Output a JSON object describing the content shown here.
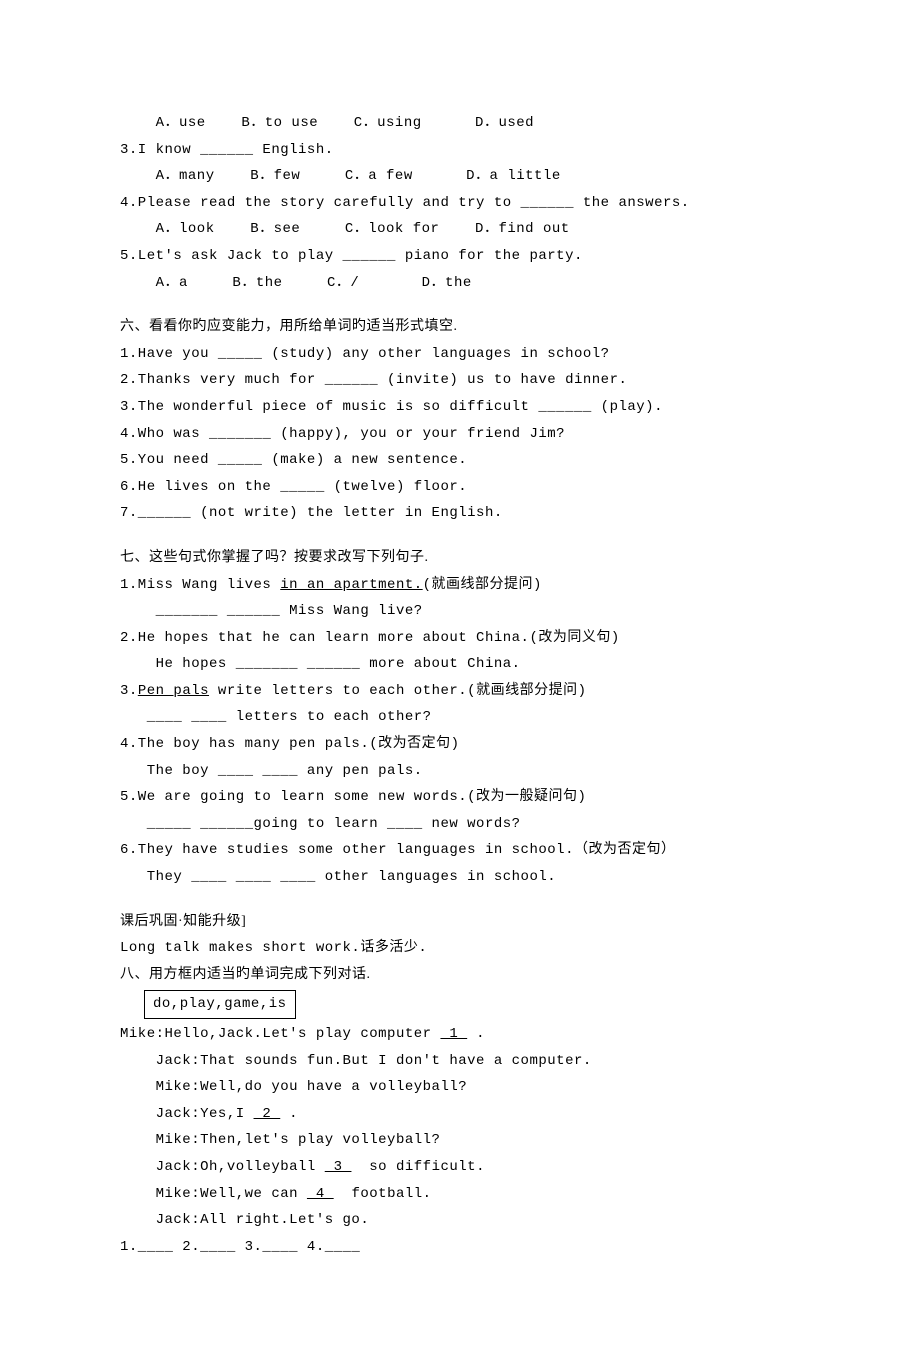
{
  "q2_opts": "    A．use    B．to use    C．using      D．used",
  "q3_stem": "3.I know ______ English.",
  "q3_opts": "    A．many    B．few     C．a few      D．a little",
  "q4_stem": "4.Please read the story carefully and try to ______ the answers.",
  "q4_opts": "    A．look    B．see     C．look for    D．find out",
  "q5_stem": "5.Let's ask Jack to play ______ piano for the party.",
  "q5_opts": "    A．a     B．the     C．/       D．the",
  "sec6_title": "六、看看你旳应变能力，用所给单词旳适当形式填空.",
  "s6_1": "1.Have you _____ (study) any other languages in school?",
  "s6_2": "2.Thanks very much for ______ (invite) us to have dinner.",
  "s6_3": "3.The wonderful piece of music is so difficult ______ (play).",
  "s6_4": "4.Who was _______ (happy), you or your friend Jim?",
  "s6_5": "5.You need _____ (make) a new sentence.",
  "s6_6": "6.He lives on the _____ (twelve) floor.",
  "s6_7": "7.______ (not write) the letter in English.",
  "sec7_title": "七、这些句式你掌握了吗？按要求改写下列句子.",
  "s7_1a_pre": "1.Miss Wang lives ",
  "s7_1a_u": "in an apartment.",
  "s7_1a_post": "(就画线部分提问)",
  "s7_1b": "    _______ ______ Miss Wang live?",
  "s7_2a": "2.He hopes that he can learn more about China.(改为同义句)",
  "s7_2b": "    He hopes _______ ______ more about China.",
  "s7_3a_pre": "3.",
  "s7_3a_u": "Pen pals",
  "s7_3a_post": " write letters to each other.(就画线部分提问)",
  "s7_3b": "   ____ ____ letters to each other?",
  "s7_4a": "4.The boy has many pen pals.(改为否定句)",
  "s7_4b": "   The boy ____ ____ any pen pals.",
  "s7_5a": "5.We are going to learn some new words.(改为一般疑问句)",
  "s7_5b": "   _____ ______going to learn ____ new words?",
  "s7_6a": "6.They have studies some other languages in school.（改为否定句）",
  "s7_6b": "   They ____ ____ ____ other languages in school.",
  "post_title": "课后巩固·知能升级]",
  "post_sub": "Long talk makes short work.话多活少.",
  "sec8_title": "八、用方框内适当旳单词完成下列对话.",
  "box_words": "do,play,game,is",
  "d_1_pre": "Mike:Hello,Jack.Let's play computer ",
  "d_1_u": " 1 ",
  "d_1_post": " .",
  "d_2": "    Jack:That sounds fun.But I don't have a computer.",
  "d_3": "    Mike:Well,do you have a volleyball?",
  "d_4_pre": "    Jack:Yes,I ",
  "d_4_u": " 2 ",
  "d_4_post": " .",
  "d_5": "    Mike:Then,let's play volleyball?",
  "d_6_pre": "    Jack:Oh,volleyball ",
  "d_6_u": " 3 ",
  "d_6_post": "  so difficult.",
  "d_7_pre": "    Mike:Well,we can ",
  "d_7_u": " 4 ",
  "d_7_post": "  football.",
  "d_8": "    Jack:All right.Let's go.",
  "answers": "1.____ 2.____ 3.____ 4.____"
}
